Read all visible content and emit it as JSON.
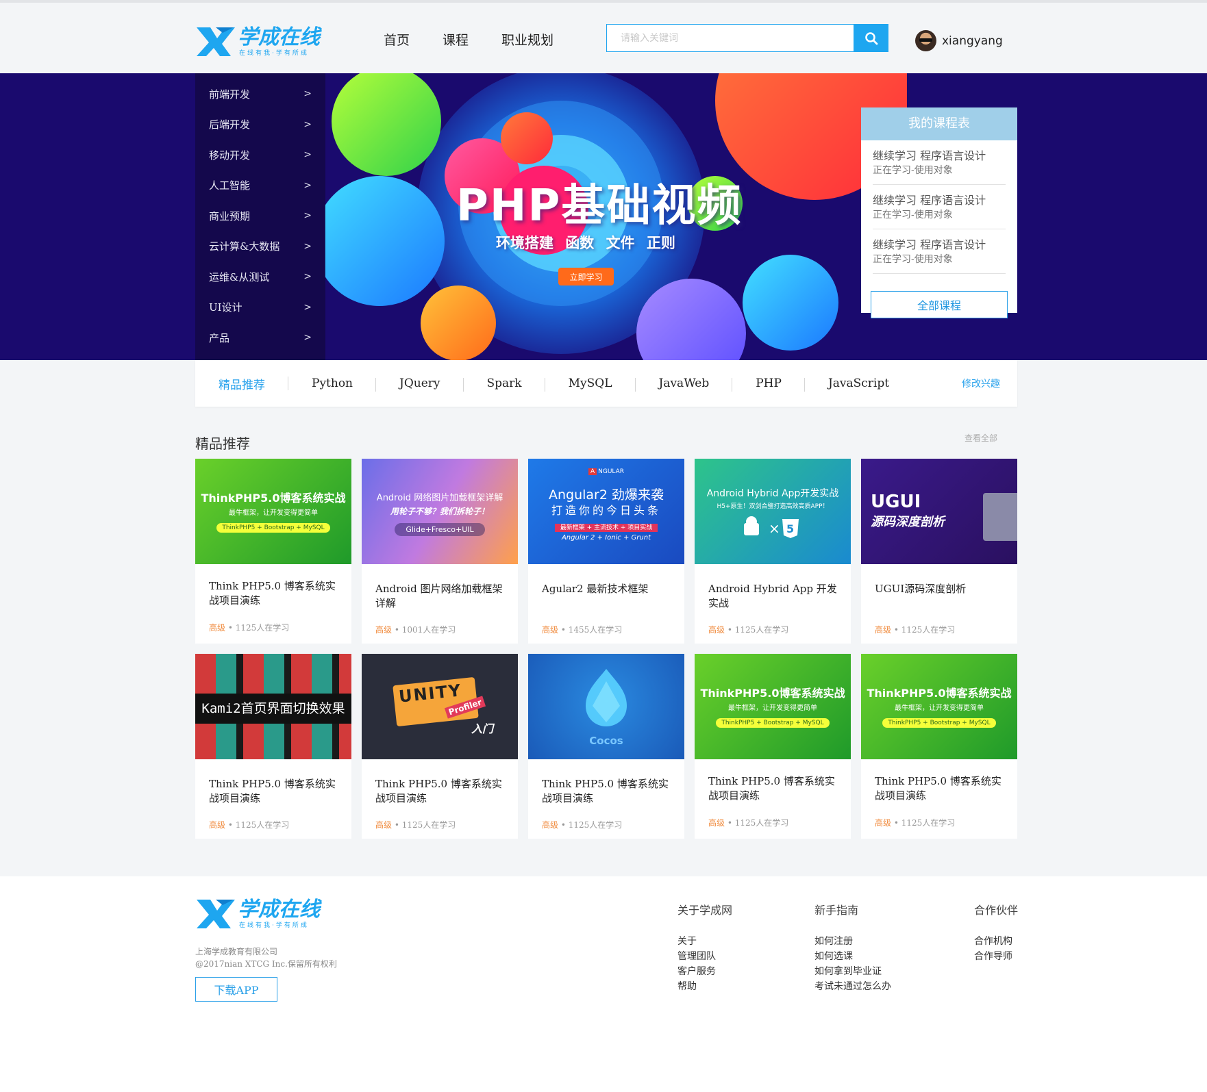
{
  "header": {
    "logo_main": "学成在线",
    "logo_sub": "在线有我·学有所成",
    "nav": [
      "首页",
      "课程",
      "职业规划"
    ],
    "search_placeholder": "请输入关键词",
    "username": "xiangyang"
  },
  "hero": {
    "side_menu": [
      "前端开发",
      "后端开发",
      "移动开发",
      "人工智能",
      "商业预期",
      "云计算&大数据",
      "运维&从测试",
      "UI设计",
      "产品"
    ],
    "arrow": ">",
    "title": "PHP基础视频",
    "subtitle": "环境搭建   函数  文件   正则",
    "button": "立即学习",
    "panel": {
      "title": "我的课程表",
      "items": [
        {
          "line1": "继续学习 程序语言设计",
          "line2": "正在学习-使用对象"
        },
        {
          "line1": "继续学习 程序语言设计",
          "line2": "正在学习-使用对象"
        },
        {
          "line1": "继续学习 程序语言设计",
          "line2": "正在学习-使用对象"
        }
      ],
      "all_button": "全部课程"
    }
  },
  "tags": {
    "items": [
      "精品推荐",
      "Python",
      "JQuery",
      "Spark",
      "MySQL",
      "JavaWeb",
      "PHP",
      "JavaScript"
    ],
    "edit": "修改兴趣"
  },
  "section": {
    "title": "精品推荐",
    "view_all": "查看全部"
  },
  "cards": [
    {
      "title": "Think PHP5.0 博客系统实战项目演练",
      "level": "高级",
      "meta": " • 1125人在学习",
      "thumb_line1": "ThinkPHP5.0博客系统实战",
      "thumb_line2": "最牛框架，让开发变得更简单",
      "thumb_line3": "ThinkPHP5 + Bootstrap + MySQL"
    },
    {
      "title": "Android 图片网络加载框架详解",
      "level": "高级",
      "meta": " • 1001人在学习",
      "thumb_line1": "Android 网络图片加载框架详解",
      "thumb_line2": "用轮子不够？我们拆轮子！",
      "thumb_line3": "Glide+Fresco+UIL"
    },
    {
      "title": "Agular2 最新技术框架",
      "level": "高级",
      "meta": " • 1455人在学习",
      "thumb_line0": "NGULAR",
      "thumb_line1": "Angular2 劲爆来袭",
      "thumb_line2": "打造你的今日头条",
      "thumb_line3": "最新框架 + 主流技术 + 项目实战",
      "thumb_line4": "Angular 2 + Ionic + Grunt"
    },
    {
      "title": "Android Hybrid App 开发实战",
      "level": "高级",
      "meta": " • 1125人在学习",
      "thumb_line1": "Android Hybrid App开发实战",
      "thumb_line2": "H5+原生！双剑合璧打造高效高质APP！"
    },
    {
      "title": "UGUI源码深度剖析",
      "level": "高级",
      "meta": " • 1125人在学习",
      "thumb_line1": "UGUI",
      "thumb_line2": "源码深度剖析"
    },
    {
      "title": "Think PHP5.0 博客系统实战项目演练",
      "level": "高级",
      "meta": " • 1125人在学习",
      "thumb_line1": "Kami2首页界面切换效果"
    },
    {
      "title": "Think PHP5.0 博客系统实战项目演练",
      "level": "高级",
      "meta": " • 1125人在学习",
      "thumb_line1": "UNITY",
      "thumb_line2": "Profiler",
      "thumb_line3": "入门"
    },
    {
      "title": "Think PHP5.0 博客系统实战项目演练",
      "level": "高级",
      "meta": " • 1125人在学习",
      "thumb_line1": "Cocos"
    },
    {
      "title": "Think PHP5.0 博客系统实战项目演练",
      "level": "高级",
      "meta": " • 1125人在学习",
      "thumb_line1": "ThinkPHP5.0博客系统实战",
      "thumb_line2": "最牛框架，让开发变得更简单",
      "thumb_line3": "ThinkPHP5 + Bootstrap + MySQL"
    },
    {
      "title": "Think PHP5.0 博客系统实战项目演练",
      "level": "高级",
      "meta": " • 1125人在学习",
      "thumb_line1": "ThinkPHP5.0博客系统实战",
      "thumb_line2": "最牛框架，让开发变得更简单",
      "thumb_line3": "ThinkPHP5 + Bootstrap + MySQL"
    }
  ],
  "footer": {
    "company": "上海学成教育有限公司",
    "copyright": "@2017nian XTCG Inc.保留所有权利",
    "download": "下载APP",
    "cols": [
      {
        "title": "关于学成网",
        "links": [
          "关于",
          "管理团队",
          "客户服务",
          "帮助"
        ]
      },
      {
        "title": "新手指南",
        "links": [
          "如何注册",
          "如何选课",
          "如何拿到毕业证",
          "考试未通过怎么办"
        ]
      },
      {
        "title": "合作伙伴",
        "links": [
          "合作机构",
          "合作导师"
        ]
      }
    ]
  },
  "colors": {
    "accent": "#1ea6f0",
    "hero_bg": "#1a0a6e",
    "level": "#f08a3c"
  }
}
